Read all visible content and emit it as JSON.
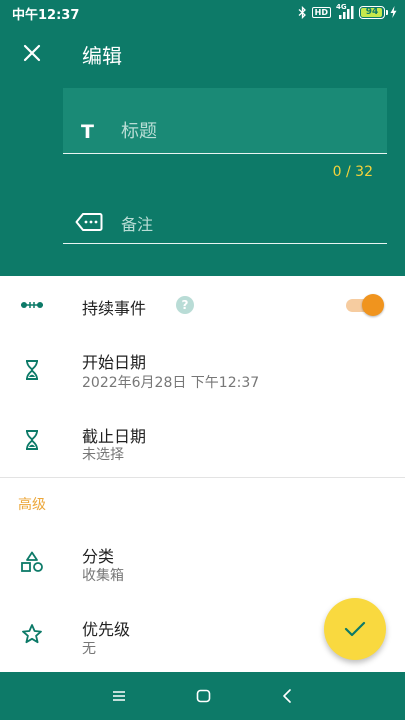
{
  "status_bar": {
    "time": "中午12:37",
    "hd_label": "HD",
    "network_label": "4G",
    "battery_level": 94,
    "battery_text": "94"
  },
  "top_bar": {
    "title": "编辑",
    "close_icon": "close-icon"
  },
  "title_field": {
    "placeholder": "标题",
    "icon_glyph": "T",
    "value": "",
    "counter": "0 / 32"
  },
  "note_field": {
    "placeholder": "备注",
    "value": ""
  },
  "duration_event": {
    "label": "持续事件",
    "help_glyph": "?",
    "enabled": true
  },
  "start_date": {
    "label": "开始日期",
    "value": "2022年6月28日 下午12:37"
  },
  "end_date": {
    "label": "截止日期",
    "value": "未选择"
  },
  "advanced": {
    "section_title": "高级",
    "category": {
      "label": "分类",
      "value": "收集箱"
    },
    "priority": {
      "label": "优先级",
      "value": "无"
    }
  },
  "colors": {
    "primary": "#0d7a68",
    "accent_yellow": "#f9d93f",
    "accent_orange": "#f0941e",
    "section_text": "#eca73a"
  }
}
